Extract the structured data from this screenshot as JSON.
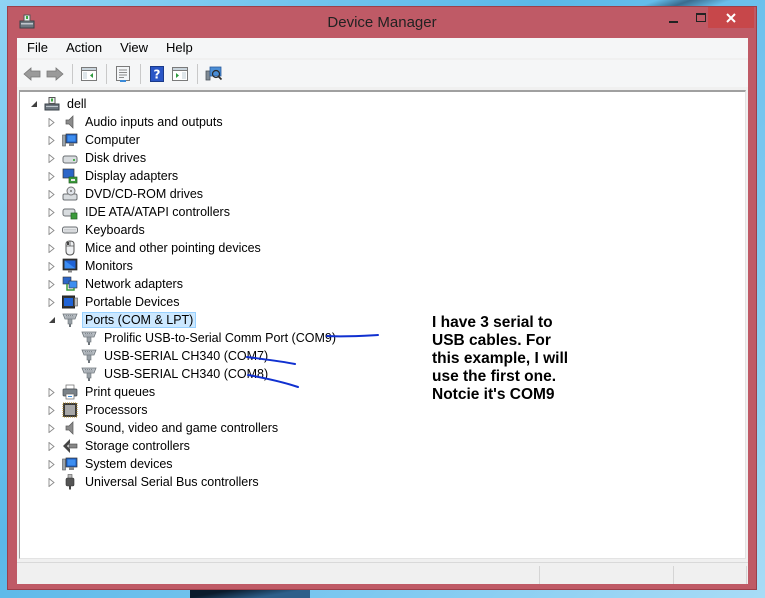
{
  "window": {
    "title": "Device Manager",
    "accent_color": "#bf5a66",
    "close_color": "#c7474a"
  },
  "menu": {
    "items": [
      {
        "label": "File"
      },
      {
        "label": "Action"
      },
      {
        "label": "View"
      },
      {
        "label": "Help"
      }
    ]
  },
  "toolbar": {
    "buttons": [
      {
        "icon": "back-arrow-icon"
      },
      {
        "icon": "forward-arrow-icon"
      },
      {
        "icon": "show-hide-console-tree-icon"
      },
      {
        "icon": "properties-icon"
      },
      {
        "icon": "help-icon"
      },
      {
        "icon": "show-action-pane-icon"
      },
      {
        "icon": "scan-hardware-changes-icon"
      }
    ]
  },
  "tree": {
    "root": {
      "label": "dell",
      "expanded": true,
      "icon": "computer-root-icon"
    },
    "categories": [
      {
        "label": "Audio inputs and outputs",
        "icon": "speaker-icon",
        "expanded": false
      },
      {
        "label": "Computer",
        "icon": "computer-icon",
        "expanded": false
      },
      {
        "label": "Disk drives",
        "icon": "disk-drive-icon",
        "expanded": false
      },
      {
        "label": "Display adapters",
        "icon": "display-adapter-icon",
        "expanded": false
      },
      {
        "label": "DVD/CD-ROM drives",
        "icon": "dvd-drive-icon",
        "expanded": false
      },
      {
        "label": "IDE ATA/ATAPI controllers",
        "icon": "ide-controller-icon",
        "expanded": false
      },
      {
        "label": "Keyboards",
        "icon": "keyboard-icon",
        "expanded": false
      },
      {
        "label": "Mice and other pointing devices",
        "icon": "mouse-icon",
        "expanded": false
      },
      {
        "label": "Monitors",
        "icon": "monitor-icon",
        "expanded": false
      },
      {
        "label": "Network adapters",
        "icon": "network-adapter-icon",
        "expanded": false
      },
      {
        "label": "Portable Devices",
        "icon": "portable-device-icon",
        "expanded": false
      },
      {
        "label": "Ports (COM & LPT)",
        "icon": "port-icon",
        "expanded": true,
        "selected": true,
        "children": [
          {
            "label": "Prolific USB-to-Serial Comm Port (COM9)",
            "icon": "port-icon"
          },
          {
            "label": "USB-SERIAL CH340 (COM7)",
            "icon": "port-icon"
          },
          {
            "label": "USB-SERIAL CH340 (COM8)",
            "icon": "port-icon"
          }
        ]
      },
      {
        "label": "Print queues",
        "icon": "printer-icon",
        "expanded": false
      },
      {
        "label": "Processors",
        "icon": "processor-icon",
        "expanded": false
      },
      {
        "label": "Sound, video and game controllers",
        "icon": "speaker-icon",
        "expanded": false
      },
      {
        "label": "Storage controllers",
        "icon": "storage-controller-icon",
        "expanded": false
      },
      {
        "label": "System devices",
        "icon": "computer-icon",
        "expanded": false
      },
      {
        "label": "Universal Serial Bus controllers",
        "icon": "usb-plug-icon",
        "expanded": false
      }
    ]
  },
  "annotation": {
    "text": "I have 3 serial to\nUSB cables. For\nthis example, I will\nuse the first one.\nNotcie it's COM9",
    "ink_color": "#1030d0"
  },
  "statusbar": {
    "sections": [
      "",
      "",
      ""
    ]
  }
}
